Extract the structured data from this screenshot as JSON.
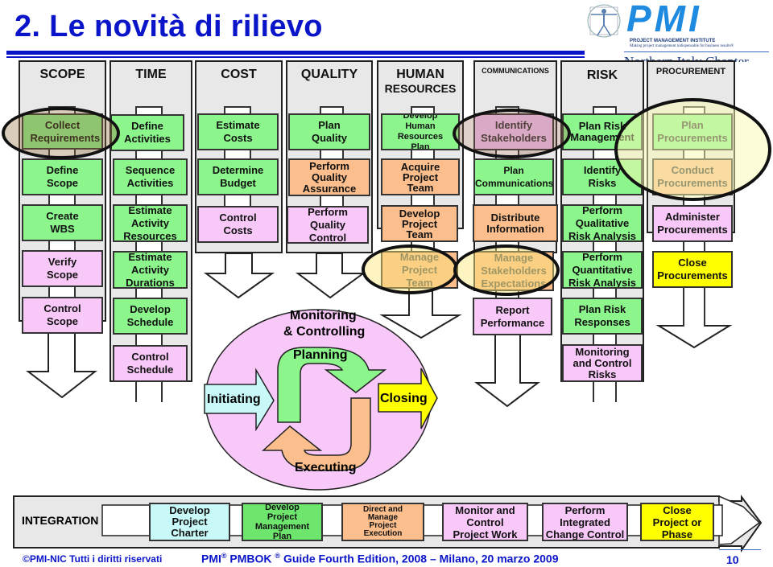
{
  "slide": {
    "title": "2. Le novità di rilievo",
    "page_number": "10",
    "footer_left": "©PMI-NIC  Tutti i diritti riservati",
    "footer_center_prefix": "PMI",
    "footer_center_mid": " PMBOK ",
    "footer_center_suffix": " Guide Fourth Edition, 2008 – Milano, 20 marzo 2009",
    "registered_mark": "®"
  },
  "logo": {
    "wordmark": "PMI",
    "institute": "PROJECT MANAGEMENT INSTITUTE",
    "tagline": "Making project management indispensable for business results®",
    "chapter_partial": "Northern Italy Chapter",
    "icon": "vitruvian-man-icon",
    "color": "#1e8be0"
  },
  "colors": {
    "title_blue": "#0a14c8",
    "planning_green": "#8cf58c",
    "executing_orange": "#fbbe8c",
    "monitoring_pink": "#f8c8f8",
    "closing_yellow": "#ffff00",
    "initiating_cyan": "#c8f8f8",
    "column_gray": "#e8e8e8"
  },
  "knowledge_areas": [
    {
      "name": "SCOPE",
      "processes": [
        {
          "label": "Collect Requirements",
          "group": "planning",
          "highlight": "new"
        },
        {
          "label": "Define Scope",
          "group": "planning"
        },
        {
          "label": "Create WBS",
          "group": "planning"
        },
        {
          "label": "Verify Scope",
          "group": "monitoring"
        },
        {
          "label": "Control Scope",
          "group": "monitoring"
        }
      ]
    },
    {
      "name": "TIME",
      "processes": [
        {
          "label": "Define Activities",
          "group": "planning"
        },
        {
          "label": "Sequence Activities",
          "group": "planning"
        },
        {
          "label": "Estimate Activity Resources",
          "group": "planning"
        },
        {
          "label": "Estimate Activity Durations",
          "group": "planning"
        },
        {
          "label": "Develop Schedule",
          "group": "planning"
        },
        {
          "label": "Control Schedule",
          "group": "monitoring"
        }
      ]
    },
    {
      "name": "COST",
      "processes": [
        {
          "label": "Estimate Costs",
          "group": "planning"
        },
        {
          "label": "Determine Budget",
          "group": "planning"
        },
        {
          "label": "Control Costs",
          "group": "monitoring"
        }
      ]
    },
    {
      "name": "QUALITY",
      "processes": [
        {
          "label": "Plan Quality",
          "group": "planning"
        },
        {
          "label": "Perform Quality Assurance",
          "group": "executing"
        },
        {
          "label": "Perform Quality Control",
          "group": "monitoring"
        }
      ]
    },
    {
      "name_line1": "HUMAN",
      "name_line2": "RESOURCES",
      "processes": [
        {
          "label_lines": [
            "Develop",
            "Human Resources",
            "Plan"
          ],
          "group": "planning"
        },
        {
          "label": "Acquire Project Team",
          "group": "executing"
        },
        {
          "label": "Develop Project Team",
          "group": "executing"
        },
        {
          "label": "Manage Project Team",
          "group": "executing",
          "highlight": "changed"
        }
      ]
    },
    {
      "name": "COMMUNICATIONS",
      "processes": [
        {
          "label": "Identify Stakeholders",
          "group": "initiating",
          "highlight": "new"
        },
        {
          "label": "Plan Communications",
          "group": "planning"
        },
        {
          "label": "Distribute Information",
          "group": "executing"
        },
        {
          "label": "Manage Stakeholders Expectations",
          "group": "executing",
          "highlight": "changed"
        },
        {
          "label": "Report Performance",
          "group": "monitoring"
        }
      ]
    },
    {
      "name": "RISK",
      "processes": [
        {
          "label": "Plan Risk Management",
          "group": "planning"
        },
        {
          "label": "Identify Risks",
          "group": "planning"
        },
        {
          "label": "Perform Qualitative Risk Analysis",
          "group": "planning"
        },
        {
          "label": "Perform Quantitative Risk Analysis",
          "group": "planning"
        },
        {
          "label": "Plan Risk Responses",
          "group": "planning"
        },
        {
          "label": "Monitoring and Control Risks",
          "group": "monitoring"
        }
      ]
    },
    {
      "name": "PROCUREMENT",
      "processes": [
        {
          "label": "Plan Procurements",
          "group": "planning",
          "highlight": "changed"
        },
        {
          "label": "Conduct Procurements",
          "group": "executing",
          "highlight": "changed"
        },
        {
          "label": "Administer Procurements",
          "group": "monitoring"
        },
        {
          "label": "Close Procurements",
          "group": "closing"
        }
      ]
    }
  ],
  "cycle": {
    "monitoring": "Monitoring",
    "monitoring2": "& Controlling",
    "planning": "Planning",
    "initiating": "Initiating",
    "closing": "Closing",
    "executing": "Executing"
  },
  "integration": {
    "label": "INTEGRATION",
    "processes": [
      {
        "lines": [
          "Develop",
          "Project",
          "Charter"
        ],
        "group": "initiating"
      },
      {
        "lines": [
          "Develop",
          "Project",
          "Management",
          "Plan"
        ],
        "group": "planning"
      },
      {
        "lines": [
          "Direct and",
          "Manage",
          "Project",
          "Execution"
        ],
        "group": "executing"
      },
      {
        "lines": [
          "Monitor and",
          "Control",
          "Project Work"
        ],
        "group": "monitoring"
      },
      {
        "lines": [
          "Perform",
          "Integrated",
          "Change Control"
        ],
        "group": "monitoring"
      },
      {
        "lines": [
          "Close",
          "Project or",
          "Phase"
        ],
        "group": "closing"
      }
    ]
  }
}
